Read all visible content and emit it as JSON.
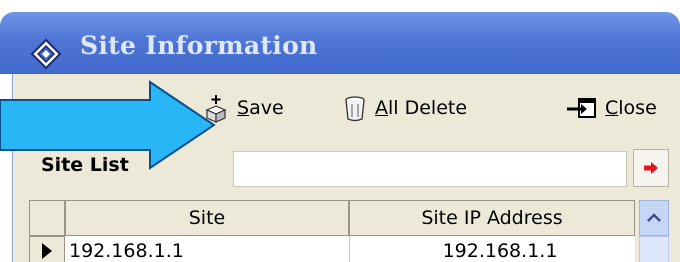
{
  "window": {
    "title": "Site Information"
  },
  "toolbar": {
    "save_mnemonic": "S",
    "save_rest": "ave",
    "alldelete_mnemonic": "A",
    "alldelete_rest": "ll Delete",
    "close_mnemonic": "C",
    "close_rest": "lose"
  },
  "site_list": {
    "label": "Site List",
    "search_value": ""
  },
  "grid": {
    "columns": [
      "Site",
      "Site IP Address"
    ],
    "rows": [
      {
        "site": "192.168.1.1",
        "ip": "192.168.1.1"
      }
    ]
  },
  "colors": {
    "titlebar": "#4f76d6",
    "toolbar": "#ece9d8",
    "arrow": "#29b6f6",
    "go_arrow": "#e8141c"
  },
  "icons": [
    "diamond-logo-icon",
    "save-icon",
    "all-delete-icon",
    "close-icon",
    "go-arrow-icon",
    "scroll-up-icon",
    "row-pointer-icon",
    "callout-arrow"
  ]
}
